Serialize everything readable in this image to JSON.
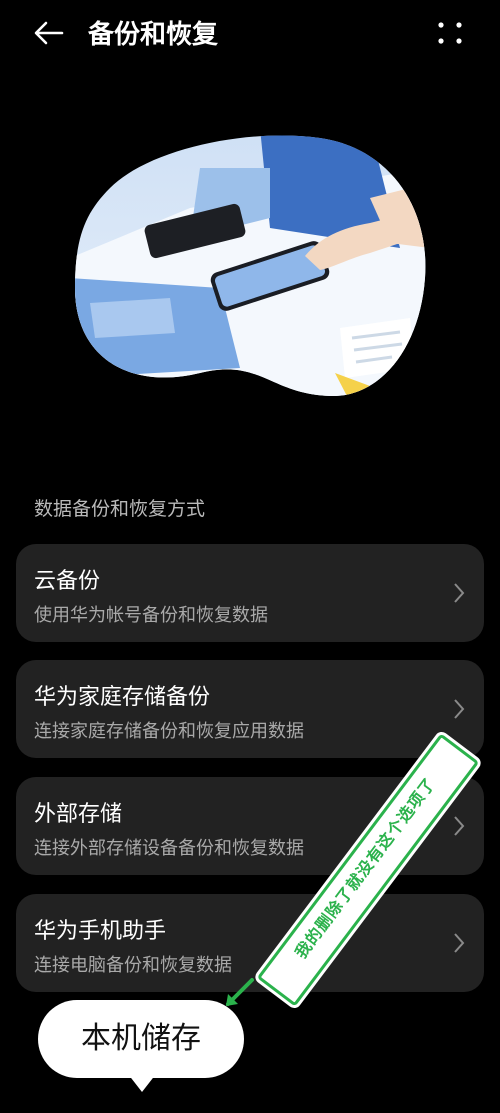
{
  "header": {
    "title": "备份和恢复",
    "back_icon": "arrow-left-icon",
    "more_icon": "more-dots-icon"
  },
  "illustration": {
    "name": "backup-hero-illustration"
  },
  "section": {
    "label": "数据备份和恢复方式"
  },
  "cards": [
    {
      "title": "云备份",
      "subtitle": "使用华为帐号备份和恢复数据"
    },
    {
      "title": "华为家庭存储备份",
      "subtitle": "连接家庭存储备份和恢复应用数据"
    },
    {
      "title": "外部存储",
      "subtitle": "连接外部存储设备备份和恢复数据"
    },
    {
      "title": "华为手机助手",
      "subtitle": "连接电脑备份和恢复数据"
    }
  ],
  "annotation": {
    "sticker_text": "我的删除了就没有这个选项了",
    "bubble_text": "本机储存"
  },
  "colors": {
    "background": "#000000",
    "card": "#222222",
    "sticker_green": "#2bb24c"
  }
}
